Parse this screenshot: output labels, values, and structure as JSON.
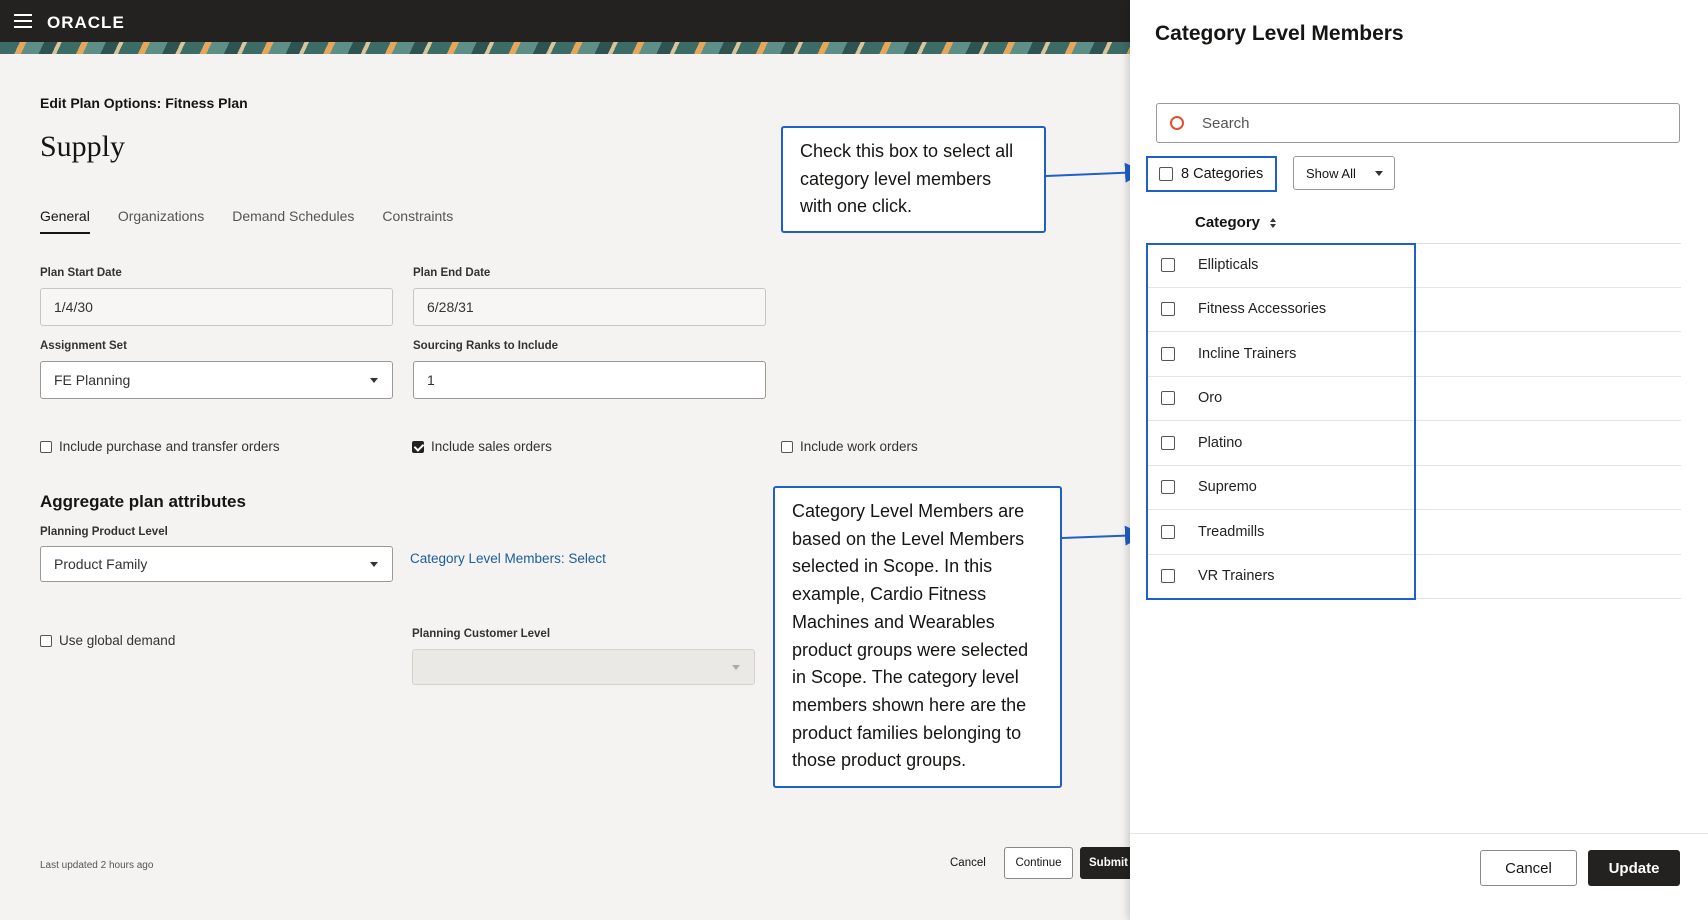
{
  "header": {
    "brand": "ORACLE"
  },
  "page": {
    "subtitle": "Edit Plan Options: Fitness Plan",
    "title": "Supply",
    "tabs": [
      "General",
      "Organizations",
      "Demand Schedules",
      "Constraints"
    ]
  },
  "form": {
    "plan_start_label": "Plan Start Date",
    "plan_start_value": "1/4/30",
    "plan_end_label": "Plan End Date",
    "plan_end_value": "6/28/31",
    "assignment_label": "Assignment Set",
    "assignment_value": "FE Planning",
    "ranks_label": "Sourcing Ranks to Include",
    "ranks_value": "1",
    "include_purchase": "Include purchase and transfer orders",
    "include_sales": "Include sales orders",
    "include_work": "Include work orders",
    "aggregate_heading": "Aggregate plan attributes",
    "product_level_label": "Planning Product Level",
    "product_level_value": "Product Family",
    "category_link": "Category Level Members: Select",
    "use_global": "Use global demand",
    "customer_level_label": "Planning Customer Level",
    "customer_level_value": ""
  },
  "footer": {
    "last_updated": "Last updated 2 hours ago",
    "cancel": "Cancel",
    "continue": "Continue",
    "submit": "Submit"
  },
  "callouts": {
    "top": "Check this box to select all category level members with one click.",
    "bottom": "Category Level Members are based on the Level Members selected in Scope. In this example, Cardio Fitness Machines and Wearables product groups were selected in Scope. The category level members shown here are the product families belonging to those product groups."
  },
  "drawer": {
    "title": "Category Level Members",
    "search_placeholder": "Search",
    "select_all_label": "8 Categories",
    "show_all": "Show All",
    "column_header": "Category",
    "categories": [
      "Ellipticals",
      "Fitness Accessories",
      "Incline Trainers",
      "Oro",
      "Platino",
      "Supremo",
      "Treadmills",
      "VR Trainers"
    ],
    "cancel": "Cancel",
    "update": "Update"
  },
  "colors": {
    "accent_blue": "#1f5fc9",
    "dark": "#232221",
    "search_icon": "#e0522f"
  }
}
